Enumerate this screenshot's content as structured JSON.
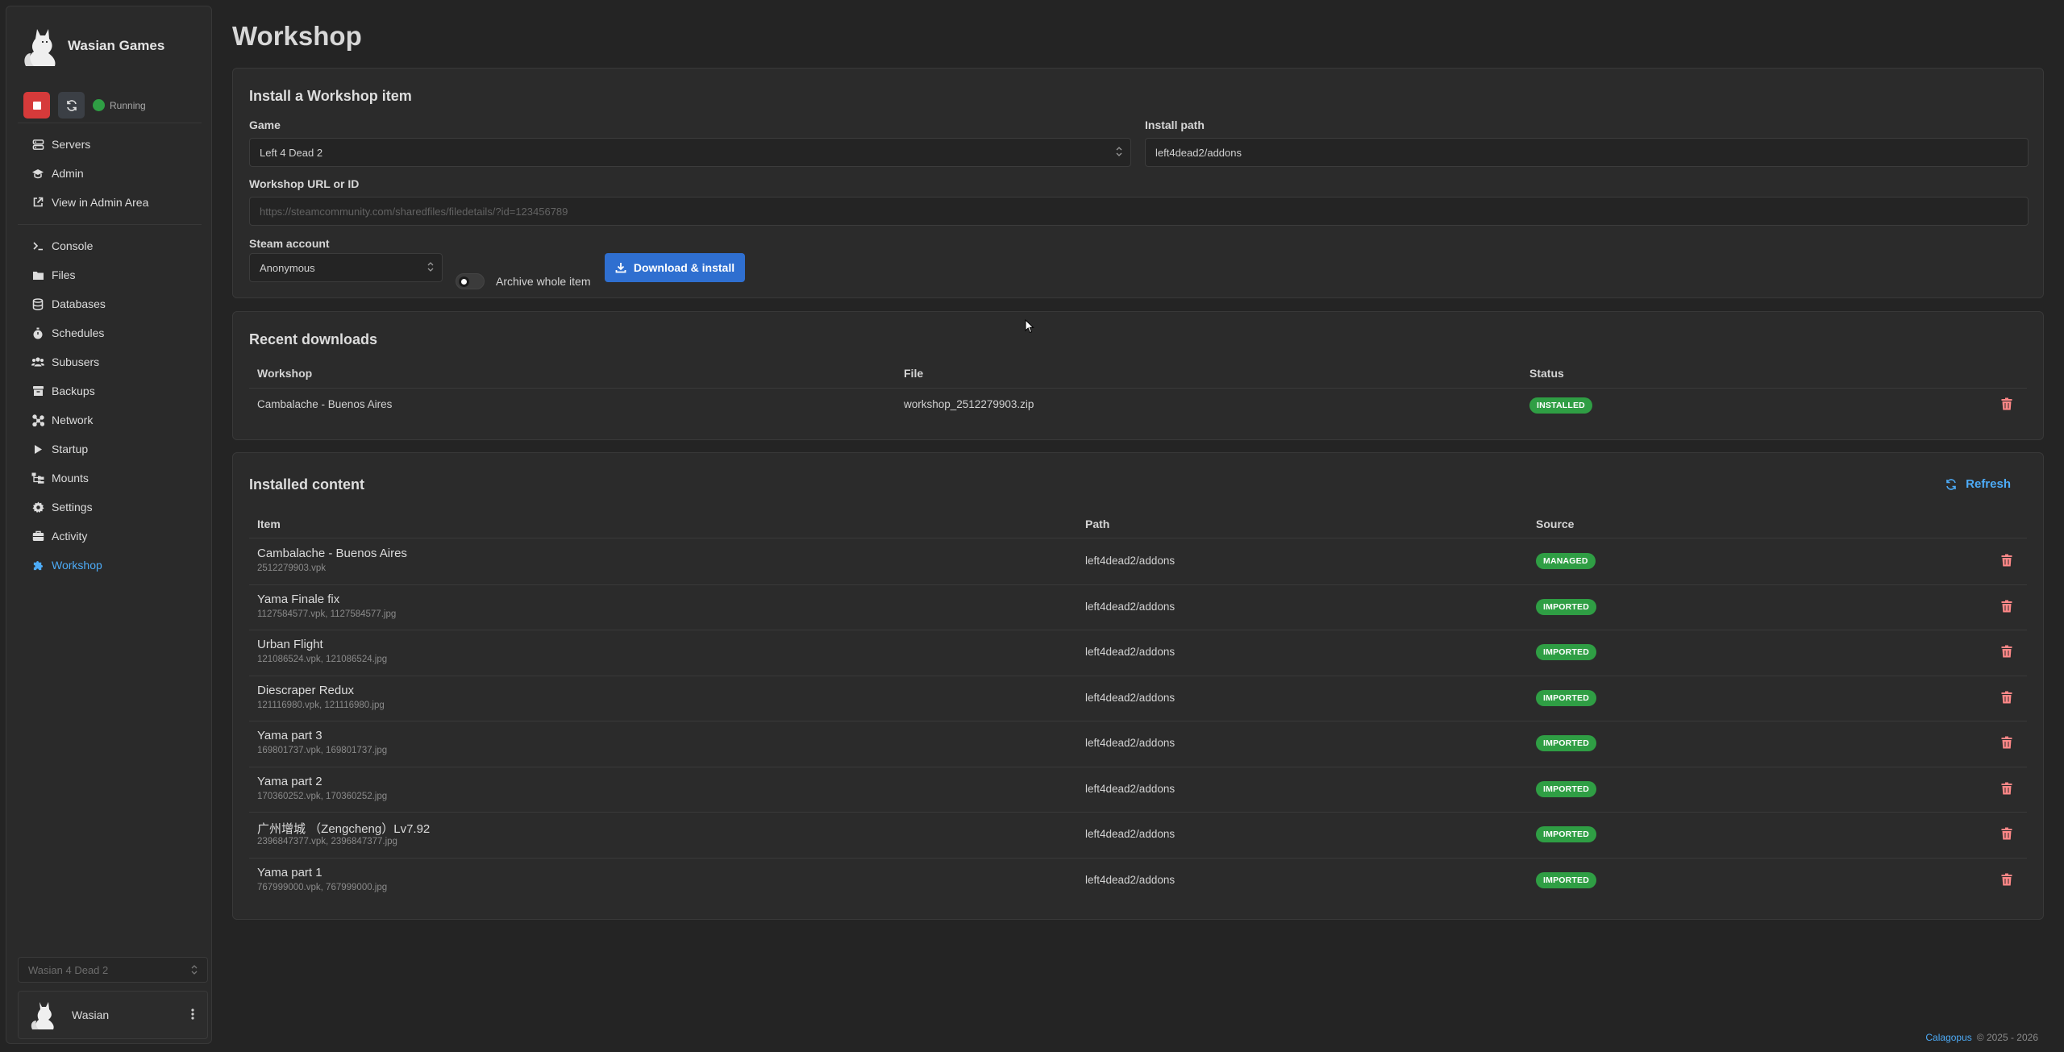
{
  "brand": {
    "name": "Wasian Games"
  },
  "server_status": {
    "label": "Running",
    "color": "#2f9e44"
  },
  "nav_primary": [
    {
      "id": "servers",
      "label": "Servers",
      "icon": "server-icon"
    },
    {
      "id": "admin",
      "label": "Admin",
      "icon": "graduation-cap-icon"
    },
    {
      "id": "admin-area",
      "label": "View in Admin Area",
      "icon": "external-link-icon"
    }
  ],
  "nav_server": [
    {
      "id": "console",
      "label": "Console",
      "icon": "terminal-icon"
    },
    {
      "id": "files",
      "label": "Files",
      "icon": "folder-icon"
    },
    {
      "id": "databases",
      "label": "Databases",
      "icon": "database-icon"
    },
    {
      "id": "schedules",
      "label": "Schedules",
      "icon": "stopwatch-icon"
    },
    {
      "id": "subusers",
      "label": "Subusers",
      "icon": "users-icon"
    },
    {
      "id": "backups",
      "label": "Backups",
      "icon": "archive-icon"
    },
    {
      "id": "network",
      "label": "Network",
      "icon": "network-icon"
    },
    {
      "id": "startup",
      "label": "Startup",
      "icon": "play-icon"
    },
    {
      "id": "mounts",
      "label": "Mounts",
      "icon": "folder-tree-icon"
    },
    {
      "id": "settings",
      "label": "Settings",
      "icon": "gear-icon"
    },
    {
      "id": "activity",
      "label": "Activity",
      "icon": "briefcase-icon"
    },
    {
      "id": "workshop",
      "label": "Workshop",
      "icon": "puzzle-icon",
      "active": true
    }
  ],
  "server_select": {
    "value": "Wasian 4 Dead 2"
  },
  "user": {
    "name": "Wasian"
  },
  "page": {
    "title": "Workshop"
  },
  "install_form": {
    "title": "Install a Workshop item",
    "game_label": "Game",
    "game_value": "Left 4 Dead 2",
    "install_path_label": "Install path",
    "install_path_value": "left4dead2/addons",
    "url_label": "Workshop URL or ID",
    "url_placeholder": "https://steamcommunity.com/sharedfiles/filedetails/?id=123456789",
    "steam_account_label": "Steam account",
    "steam_account_value": "Anonymous",
    "archive_label": "Archive whole item",
    "archive_enabled": false,
    "download_label": "Download & install"
  },
  "recent_downloads": {
    "title": "Recent downloads",
    "columns": [
      "Workshop",
      "File",
      "Status"
    ],
    "rows": [
      {
        "workshop": "Cambalache - Buenos Aires",
        "file": "workshop_2512279903.zip",
        "status": "INSTALLED"
      }
    ]
  },
  "installed_content": {
    "title": "Installed content",
    "refresh_label": "Refresh",
    "columns": [
      "Item",
      "Path",
      "Source"
    ],
    "rows": [
      {
        "name": "Cambalache - Buenos Aires",
        "files": "2512279903.vpk",
        "path": "left4dead2/addons",
        "source": "MANAGED"
      },
      {
        "name": "Yama Finale fix",
        "files": "1127584577.vpk, 1127584577.jpg",
        "path": "left4dead2/addons",
        "source": "IMPORTED"
      },
      {
        "name": "Urban Flight",
        "files": "121086524.vpk, 121086524.jpg",
        "path": "left4dead2/addons",
        "source": "IMPORTED"
      },
      {
        "name": "Diescraper Redux",
        "files": "121116980.vpk, 121116980.jpg",
        "path": "left4dead2/addons",
        "source": "IMPORTED"
      },
      {
        "name": "Yama part 3",
        "files": "169801737.vpk, 169801737.jpg",
        "path": "left4dead2/addons",
        "source": "IMPORTED"
      },
      {
        "name": "Yama part 2",
        "files": "170360252.vpk, 170360252.jpg",
        "path": "left4dead2/addons",
        "source": "IMPORTED"
      },
      {
        "name": "广州增城 （Zengcheng）Lv7.92",
        "files": "2396847377.vpk, 2396847377.jpg",
        "path": "left4dead2/addons",
        "source": "IMPORTED"
      },
      {
        "name": "Yama part 1",
        "files": "767999000.vpk, 767999000.jpg",
        "path": "left4dead2/addons",
        "source": "IMPORTED"
      }
    ]
  },
  "footer": {
    "brand": "Calagopus",
    "copyright": "© 2025 - 2026"
  }
}
